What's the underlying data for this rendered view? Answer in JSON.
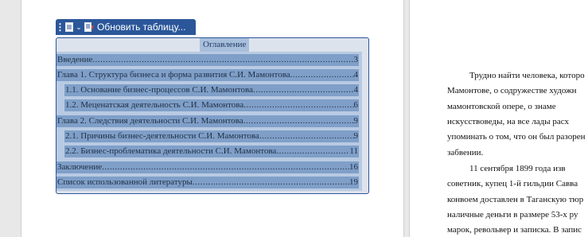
{
  "toolbar": {
    "handle_icon": "drag-handle-icon",
    "doc_icon": "document-icon",
    "caret_icon": "chevron-down-icon",
    "update_icon": "update-table-icon",
    "update_label": "Обновить таблицу..."
  },
  "toc": {
    "heading": "Оглавление",
    "entries": [
      {
        "label": "Введение",
        "page": "3"
      },
      {
        "label": "Глава 1. Структура бизнеса и форма развития С.И. Мамонтова",
        "page": "4"
      },
      {
        "label": "1.1. Основание бизнес-процессов С.И. Мамонтова",
        "page": "4"
      },
      {
        "label": "1.2. Меценатская деятельность С.И. Мамонтова",
        "page": "6"
      },
      {
        "label": "Глава 2. Следствия деятельности С.И. Мамонтова",
        "page": "9"
      },
      {
        "label": "2.1. Причины бизнес-деятельности С.И. Мамонтова",
        "page": "9"
      },
      {
        "label": "2.2. Бизнес-проблематика деятельности С.И. Мамонтова",
        "page": "11"
      },
      {
        "label": "Заключение",
        "page": "16"
      },
      {
        "label": "Список использованной литературы",
        "page": "19"
      }
    ]
  },
  "right_page": {
    "lines": [
      "Трудно найти человека, которо",
      "Мамонтове, о содружестве художн",
      "мамонтовской опере, о знаме",
      "искусствоведы, на все лады расх",
      "упоминать о том, что он был разорен",
      "забвении.",
      "11 сентября 1899 года изв",
      "советник, купец 1-й гильдии Савва",
      "конвоем доставлен в Таганскую тюр",
      "наличные деньги в размере 53-х ру",
      "марок, револьвер и записка. В запис"
    ]
  }
}
